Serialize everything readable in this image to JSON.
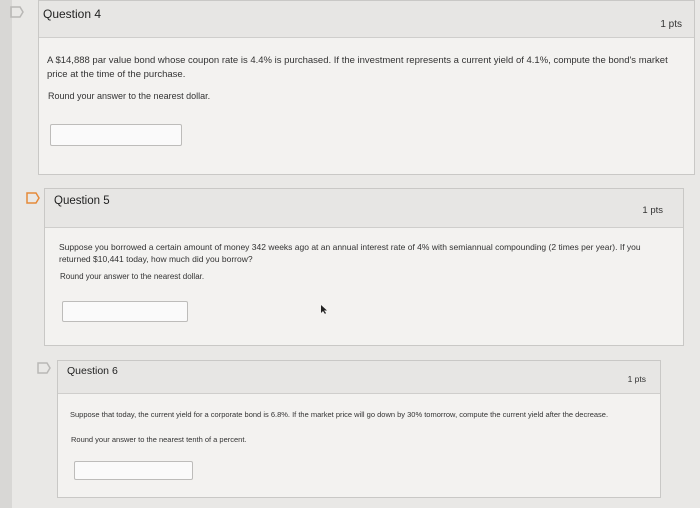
{
  "questions": [
    {
      "title": "Question 4",
      "points": "1 pts",
      "text": "A $14,888 par value bond whose coupon rate is 4.4% is purchased. If the investment represents a current yield of 4.1%, compute the bond's market price at the time of the purchase.",
      "instruction": "Round your answer to the nearest dollar.",
      "answer_value": ""
    },
    {
      "title": "Question 5",
      "points": "1 pts",
      "text": "Suppose you borrowed a certain amount of money 342 weeks ago at an annual interest rate of 4% with semiannual compounding (2 times per year). If you returned $10,441 today, how much did you borrow?",
      "instruction": "Round your answer to the nearest dollar.",
      "answer_value": ""
    },
    {
      "title": "Question 6",
      "points": "1 pts",
      "text": "Suppose that today, the current yield for a corporate bond is 6.8%. If the market price will go down by 30% tomorrow, compute the current yield after the decrease.",
      "instruction": "Round your answer to the nearest tenth of a percent.",
      "answer_value": ""
    }
  ],
  "colors": {
    "flag": "#b9b8b6",
    "flag_active": "#e58a3a"
  }
}
